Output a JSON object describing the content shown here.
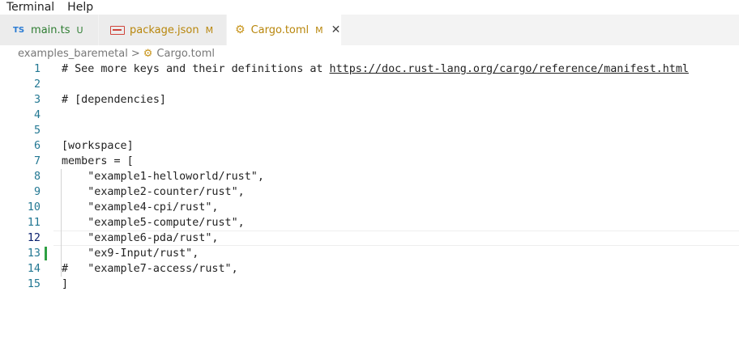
{
  "menu": {
    "items": [
      "Terminal",
      "Help"
    ]
  },
  "tabs": [
    {
      "icon": "TS",
      "label": "main.ts",
      "status": "U",
      "active": false
    },
    {
      "icon": "json-icon",
      "label": "package.json",
      "status": "M",
      "active": false
    },
    {
      "icon": "gear-icon",
      "label": "Cargo.toml",
      "status": "M",
      "active": true,
      "close": "✕"
    }
  ],
  "breadcrumb": {
    "folder": "examples_baremetal",
    "separator": ">",
    "file": "Cargo.toml"
  },
  "editor": {
    "current_line": 12,
    "lines": [
      {
        "n": "1",
        "text": "# See more keys and their definitions at ",
        "link": "https://doc.rust-lang.org/cargo/reference/manifest.html"
      },
      {
        "n": "2",
        "text": ""
      },
      {
        "n": "3",
        "text": "# [dependencies]"
      },
      {
        "n": "4",
        "text": ""
      },
      {
        "n": "5",
        "text": ""
      },
      {
        "n": "6",
        "text": "[workspace]"
      },
      {
        "n": "7",
        "text": "members = ["
      },
      {
        "n": "8",
        "text": "    \"example1-helloworld/rust\","
      },
      {
        "n": "9",
        "text": "    \"example2-counter/rust\","
      },
      {
        "n": "10",
        "text": "    \"example4-cpi/rust\","
      },
      {
        "n": "11",
        "text": "    \"example5-compute/rust\","
      },
      {
        "n": "12",
        "text": "    \"example6-pda/rust\","
      },
      {
        "n": "13",
        "text": "    \"ex9-Input/rust\","
      },
      {
        "n": "14",
        "text": "#   \"example7-access/rust\","
      },
      {
        "n": "15",
        "text": "]"
      }
    ]
  }
}
